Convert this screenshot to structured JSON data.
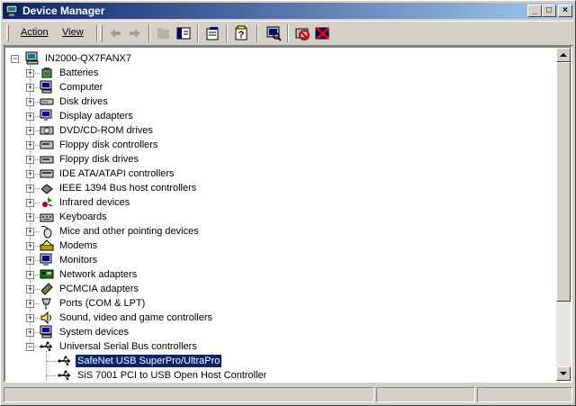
{
  "window": {
    "title": "Device Manager"
  },
  "menu": {
    "action": "Action",
    "view": "View"
  },
  "toolbar": {
    "buttons": [
      "back-icon",
      "forward-icon",
      "up-icon",
      "show-hide-tree-icon",
      "properties-icon",
      "help-icon",
      "scan-hardware-icon",
      "uninstall-icon",
      "disable-icon"
    ]
  },
  "tree": {
    "root": "IN2000-QX7FANX7",
    "categories": [
      {
        "label": "Batteries",
        "icon": "battery-icon"
      },
      {
        "label": "Computer",
        "icon": "computer-icon"
      },
      {
        "label": "Disk drives",
        "icon": "disk-drive-icon"
      },
      {
        "label": "Display adapters",
        "icon": "display-adapter-icon"
      },
      {
        "label": "DVD/CD-ROM drives",
        "icon": "cdrom-icon"
      },
      {
        "label": "Floppy disk controllers",
        "icon": "floppy-controller-icon"
      },
      {
        "label": "Floppy disk drives",
        "icon": "floppy-drive-icon"
      },
      {
        "label": "IDE ATA/ATAPI controllers",
        "icon": "ide-controller-icon"
      },
      {
        "label": "IEEE 1394 Bus host controllers",
        "icon": "ieee1394-icon"
      },
      {
        "label": "Infrared devices",
        "icon": "infrared-icon"
      },
      {
        "label": "Keyboards",
        "icon": "keyboard-icon"
      },
      {
        "label": "Mice and other pointing devices",
        "icon": "mouse-icon"
      },
      {
        "label": "Modems",
        "icon": "modem-icon"
      },
      {
        "label": "Monitors",
        "icon": "monitor-icon"
      },
      {
        "label": "Network adapters",
        "icon": "network-adapter-icon"
      },
      {
        "label": "PCMCIA adapters",
        "icon": "pcmcia-icon"
      },
      {
        "label": "Ports (COM & LPT)",
        "icon": "port-icon"
      },
      {
        "label": "Sound, video and game controllers",
        "icon": "sound-icon"
      },
      {
        "label": "System devices",
        "icon": "system-devices-icon"
      },
      {
        "label": "Universal Serial Bus controllers",
        "icon": "usb-icon",
        "expanded": true
      }
    ],
    "usb_children": [
      {
        "label": "SafeNet USB SuperPro/UltraPro",
        "selected": true
      },
      {
        "label": "SiS 7001 PCI to USB Open Host Controller"
      }
    ]
  }
}
